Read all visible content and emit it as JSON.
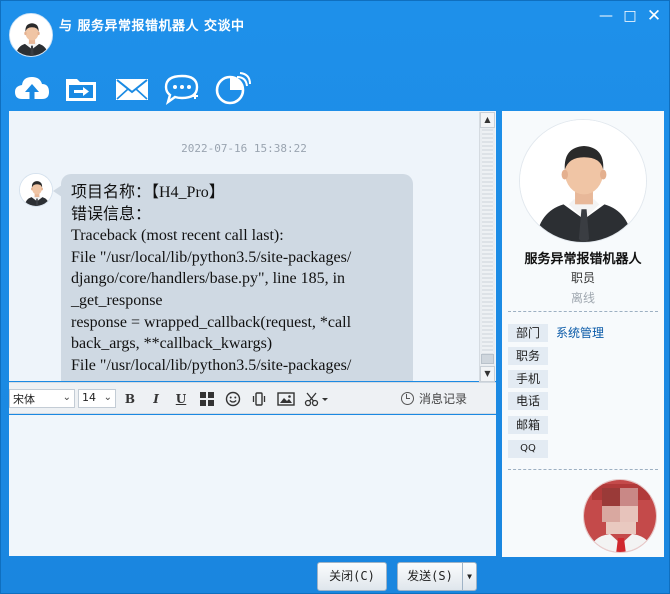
{
  "window": {
    "title": "与 服务异常报错机器人 交谈中",
    "controls": [
      "—",
      "□",
      "✕"
    ]
  },
  "toolbar": {
    "icons": [
      "upload-cloud-icon",
      "folder-send-icon",
      "mail-icon",
      "chat-add-icon",
      "remote-assist-icon"
    ]
  },
  "chat": {
    "timestamp": "2022-07-16 15:38:22",
    "message_lines": [
      "项目名称：【H4_Pro】",
      "错误信息：",
      "Traceback (most recent call last):",
      "File \"/usr/local/lib/python3.5/site-packages/",
      "django/core/handlers/base.py\", line 185, in",
      "_get_response",
      "response = wrapped_callback(request, *call",
      "back_args, **callback_kwargs)",
      "File \"/usr/local/lib/python3.5/site-packages/"
    ]
  },
  "format_bar": {
    "font_family": "宋体",
    "font_size": "14",
    "bold": "B",
    "italic": "I",
    "underline": "U",
    "history_label": "消息记录"
  },
  "buttons": {
    "close": "关闭(C)",
    "send": "发送(S)"
  },
  "profile": {
    "name": "服务异常报错机器人",
    "role": "职员",
    "status": "离线",
    "fields": [
      {
        "label": "部门",
        "value": "系统管理"
      },
      {
        "label": "职务",
        "value": ""
      },
      {
        "label": "手机",
        "value": ""
      },
      {
        "label": "电话",
        "value": ""
      },
      {
        "label": "邮箱",
        "value": ""
      },
      {
        "label": "QQ",
        "value": ""
      }
    ]
  },
  "colors": {
    "frame": "#1a8ae3",
    "bubble": "#cfd9e3",
    "link": "#0a5aa8"
  }
}
